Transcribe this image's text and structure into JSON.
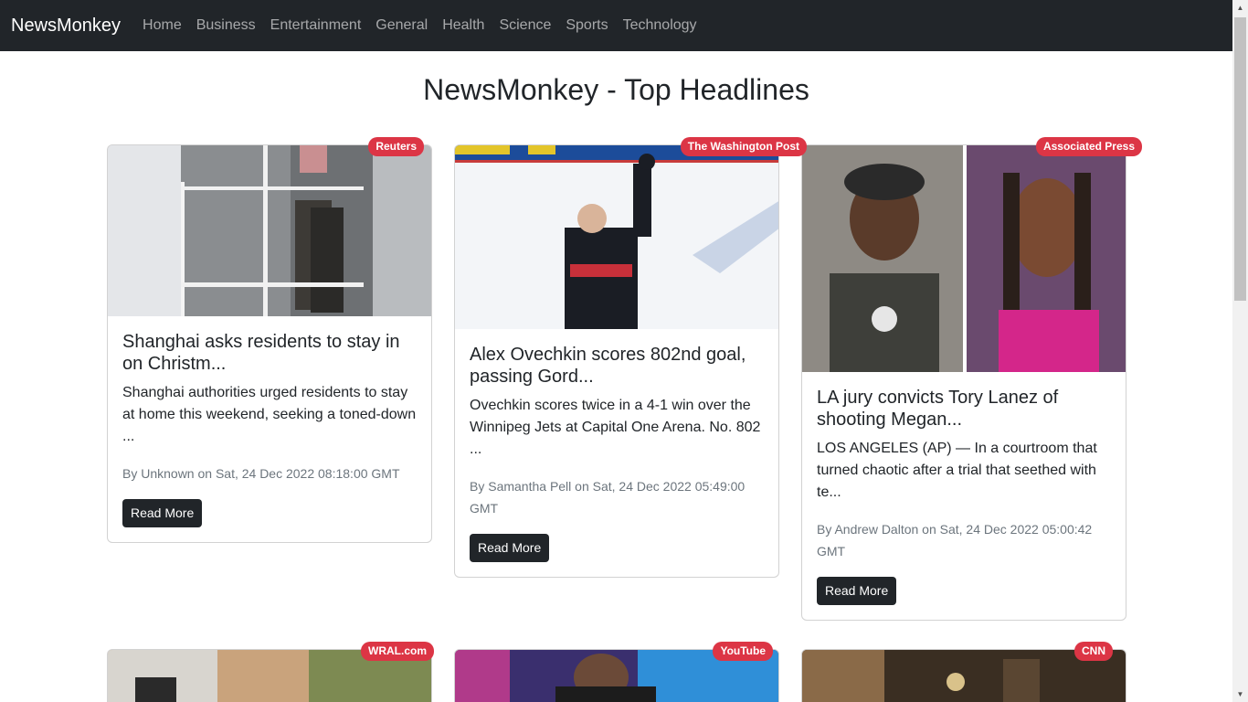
{
  "navbar": {
    "brand": "NewsMonkey",
    "links": [
      "Home",
      "Business",
      "Entertainment",
      "General",
      "Health",
      "Science",
      "Sports",
      "Technology"
    ]
  },
  "page_title": "NewsMonkey - Top Headlines",
  "cards": [
    {
      "source": "Reuters",
      "title": "Shanghai asks residents to stay in on Christm...",
      "description": "Shanghai authorities urged residents to stay at home this weekend, seeking a toned-down ...",
      "meta": "By Unknown on Sat, 24 Dec 2022 08:18:00 GMT",
      "button": "Read More"
    },
    {
      "source": "The Washington Post",
      "title": "Alex Ovechkin scores 802nd goal, passing Gord...",
      "description": "Ovechkin scores twice in a 4-1 win over the Winnipeg Jets at Capital One Arena. No. 802 ...",
      "meta": "By Samantha Pell on Sat, 24 Dec 2022 05:49:00 GMT",
      "button": "Read More"
    },
    {
      "source": "Associated Press",
      "title": "LA jury convicts Tory Lanez of shooting Megan...",
      "description": "LOS ANGELES (AP) — In a courtroom that turned chaotic after a trial that seethed with te...",
      "meta": "By Andrew Dalton on Sat, 24 Dec 2022 05:00:42 GMT",
      "button": "Read More"
    },
    {
      "source": "WRAL.com"
    },
    {
      "source": "YouTube"
    },
    {
      "source": "CNN"
    }
  ],
  "colors": {
    "navbar_bg": "#212529",
    "badge": "#dc3545",
    "button_bg": "#212529"
  }
}
